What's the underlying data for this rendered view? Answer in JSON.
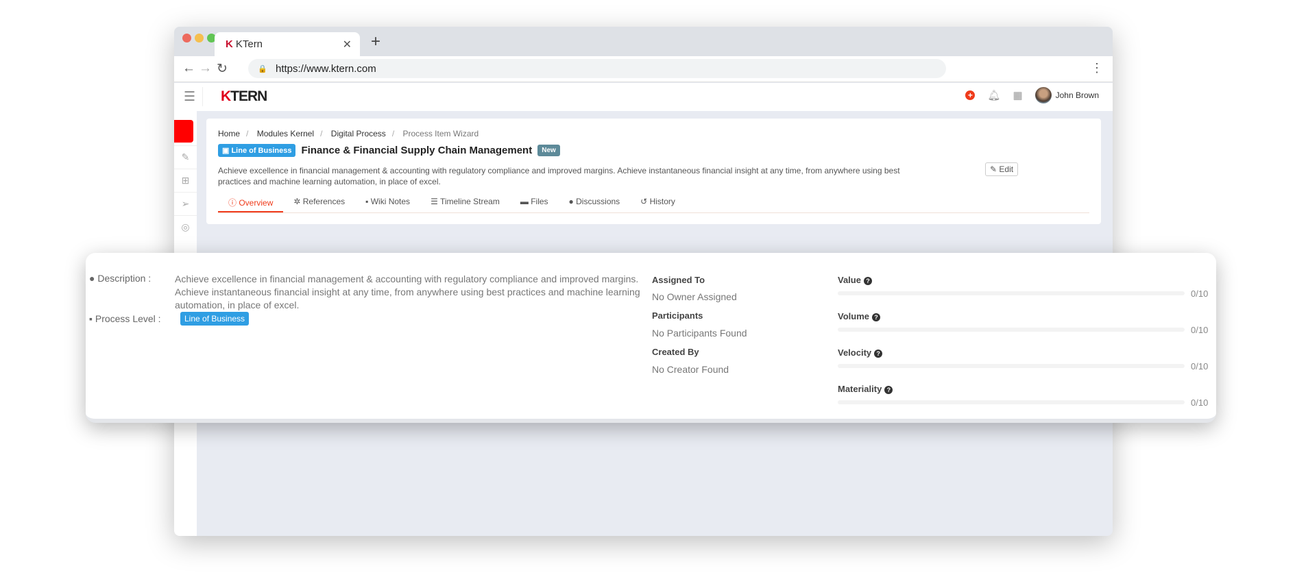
{
  "browser": {
    "tab_title": "KTern",
    "url": "https://www.ktern.com"
  },
  "header": {
    "logo": "KTERN",
    "user_name": "John Brown"
  },
  "breadcrumb": [
    "Home",
    "Modules Kernel",
    "Digital Process",
    "Process Item Wizard"
  ],
  "item": {
    "level_badge": "Line of Business",
    "title": "Finance & Financial Supply Chain Management",
    "status_badge": "New",
    "description": "Achieve excellence in financial management & accounting with regulatory compliance and improved margins. Achieve instantaneous financial insight at any time, from anywhere using best practices and machine learning automation, in place of excel.",
    "edit_label": "Edit"
  },
  "tabs": [
    {
      "label": "Overview",
      "active": true
    },
    {
      "label": "References"
    },
    {
      "label": "Wiki Notes"
    },
    {
      "label": "Timeline Stream"
    },
    {
      "label": "Files"
    },
    {
      "label": "Discussions"
    },
    {
      "label": "History"
    }
  ],
  "overview": {
    "description_label": "Description :",
    "description": "Achieve excellence in financial management & accounting with regulatory compliance and improved margins. Achieve instantaneous financial insight at any time, from anywhere using best practices and machine learning automation, in place of excel.",
    "process_level_label": "Process Level :",
    "process_level": "Line of Business",
    "assigned_to_label": "Assigned To",
    "assigned_to": "No Owner Assigned",
    "participants_label": "Participants",
    "participants": "No Participants Found",
    "created_by_label": "Created By",
    "created_by": "No Creator Found",
    "metrics": [
      {
        "label": "Value",
        "score": "0/10",
        "value": 0,
        "max": 10
      },
      {
        "label": "Volume",
        "score": "0/10",
        "value": 0,
        "max": 10
      },
      {
        "label": "Velocity",
        "score": "0/10",
        "value": 0,
        "max": 10
      },
      {
        "label": "Materiality",
        "score": "0/10",
        "value": 0,
        "max": 10
      }
    ]
  },
  "colors": {
    "accent": "#ef3b1b",
    "badge_blue": "#2f9ee3",
    "new_badge": "#5d8a99"
  }
}
